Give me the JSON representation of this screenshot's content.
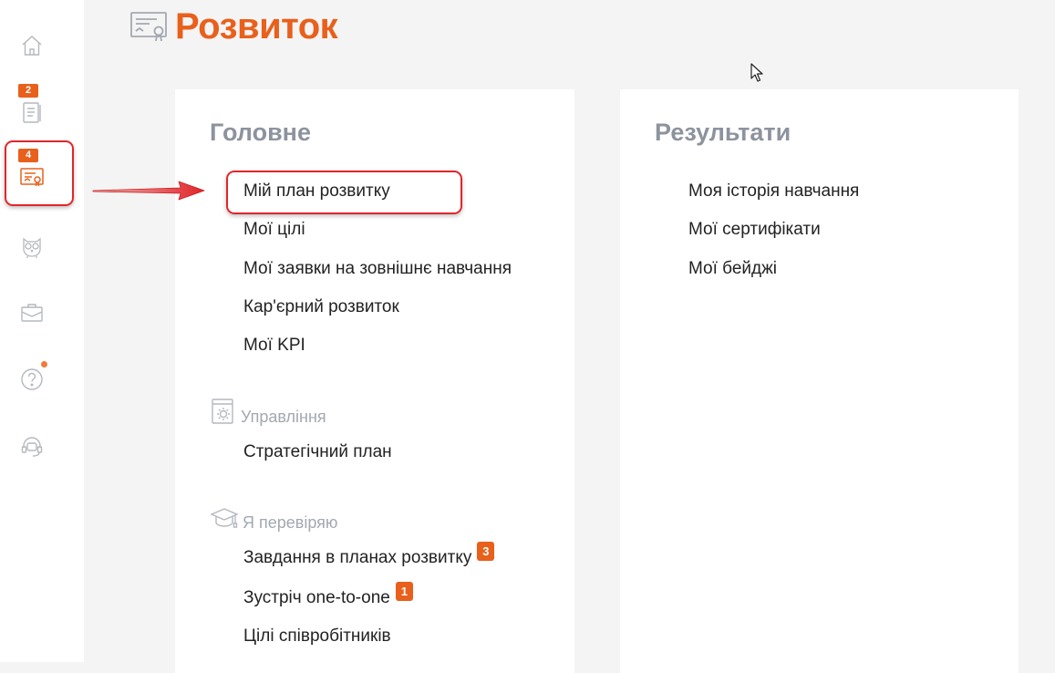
{
  "sidebar": {
    "items": [
      {
        "icon": "home-icon"
      },
      {
        "icon": "notebook-icon",
        "badge": "2"
      },
      {
        "icon": "certificate-icon",
        "badge": "4"
      },
      {
        "icon": "owl-icon"
      },
      {
        "icon": "briefcase-icon"
      },
      {
        "icon": "help-icon"
      },
      {
        "icon": "support-headset-icon"
      }
    ]
  },
  "header": {
    "title": "Розвиток",
    "icon": "certificate-icon"
  },
  "main_card": {
    "heading": "Головне",
    "links": [
      "Мій план розвитку",
      "Мої цілі",
      "Мої заявки на зовнішнє навчання",
      "Кар'єрний розвиток",
      "Мої KPI"
    ],
    "management": {
      "title": "Управління",
      "icon": "settings-document-icon",
      "links": [
        "Стратегічний план"
      ]
    },
    "review": {
      "title": "Я перевіряю",
      "icon": "graduation-cap-icon",
      "links": [
        {
          "label": "Завдання в планах розвитку",
          "count": "3"
        },
        {
          "label": "Зустріч one-to-one",
          "count": "1"
        },
        {
          "label": "Цілі співробітників"
        }
      ]
    }
  },
  "results_card": {
    "heading": "Результати",
    "links": [
      "Моя історія навчання",
      "Мої сертифікати",
      "Мої бейджі"
    ]
  },
  "colors": {
    "accent": "#e8601c",
    "annotation": "#e0262b",
    "heading_gray": "#8d939e"
  }
}
